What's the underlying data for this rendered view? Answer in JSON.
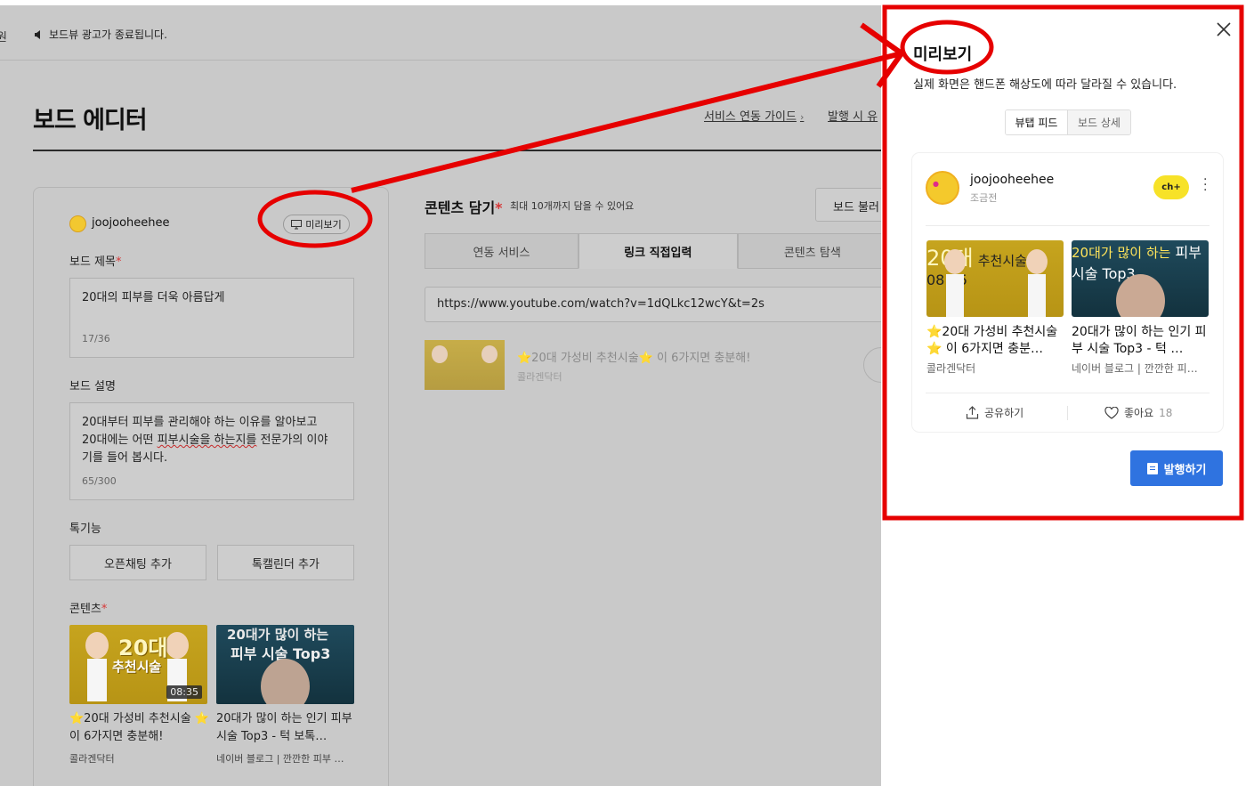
{
  "notice": {
    "cut_text": "원",
    "message": "보드뷰 광고가 종료됩니다."
  },
  "header": {
    "title": "보드 에디터",
    "guide_link": "서비스 연동 가이드",
    "publish_link": "발행 시 유"
  },
  "editor": {
    "username": "joojooheehee",
    "preview_button": "미리보기",
    "board_title_label": "보드 제목",
    "board_title_value": "20대의 피부를 더욱 아름답게",
    "board_title_count": "17/36",
    "board_desc_label": "보드 설명",
    "board_desc_line1": "20대부터 피부를 관리해야 하는 이유를 알아보고",
    "board_desc_line2_a": "20대에는 어떤 ",
    "board_desc_line2_b": "피부시술을 하는지를",
    "board_desc_line2_c": " 전문가의 이야",
    "board_desc_line3": "기를 들어 봅시다.",
    "board_desc_count": "65/300",
    "special_label": "톡기능",
    "open_chat_button": "오픈채팅 추가",
    "talk_calendar_button": "톡캘린더 추가",
    "contents_label": "콘텐츠",
    "required_mark": "*"
  },
  "contents": [
    {
      "title": "⭐20대 가성비 추천시술 ⭐ 이 6가지면 충분해!",
      "source": "콜라겐닥터",
      "duration": "08:35",
      "thumb_big": "20대",
      "thumb_sub": "추천시술"
    },
    {
      "title": "20대가 많이 하는 인기 피부 시술 Top3 - 턱 보톡…",
      "source": "네이버 블로그 | 깐깐한 피부 …",
      "thumb_line1": "20대가 많이 하는",
      "thumb_line2": "피부 시술 Top3"
    }
  ],
  "middle": {
    "title": "콘텐츠 담기",
    "subtitle": "최대 10개까지 담을 수 있어요",
    "load_button": "보드 불러",
    "tabs": [
      "연동 서비스",
      "링크 직접입력",
      "콘텐츠 탐색"
    ],
    "url_value": "https://www.youtube.com/watch?v=1dQLkc12wcY&t=2s",
    "result_title": "⭐20대 가성비 추천시술⭐ 이 6가지면 충분해!",
    "result_source": "콜라겐닥터"
  },
  "preview": {
    "title": "미리보기",
    "subtitle": "실제 화면은 핸드폰 해상도에 따라 달라질 수 있습니다.",
    "tabs": [
      "뷰탭 피드",
      "보드 상세"
    ],
    "card_user": "joojooheehee",
    "card_time": "조금전",
    "talk_label": "ch+",
    "items": [
      {
        "title": "⭐20대 가성비 추천시술⭐ 이 6가지면 충분…",
        "source": "콜라겐닥터"
      },
      {
        "title": "20대가 많이 하는 인기 피부 시술 Top3 - 턱 …",
        "source": "네이버 블로그 | 깐깐한 피…"
      }
    ],
    "share_label": "공유하기",
    "like_label": "좋아요",
    "like_count": "18",
    "publish_button": "발행하기"
  },
  "colors": {
    "annotation": "#e60000",
    "primary": "#2f73e0",
    "talk_yellow": "#f7e228",
    "overlay": "#c9c9c9"
  }
}
